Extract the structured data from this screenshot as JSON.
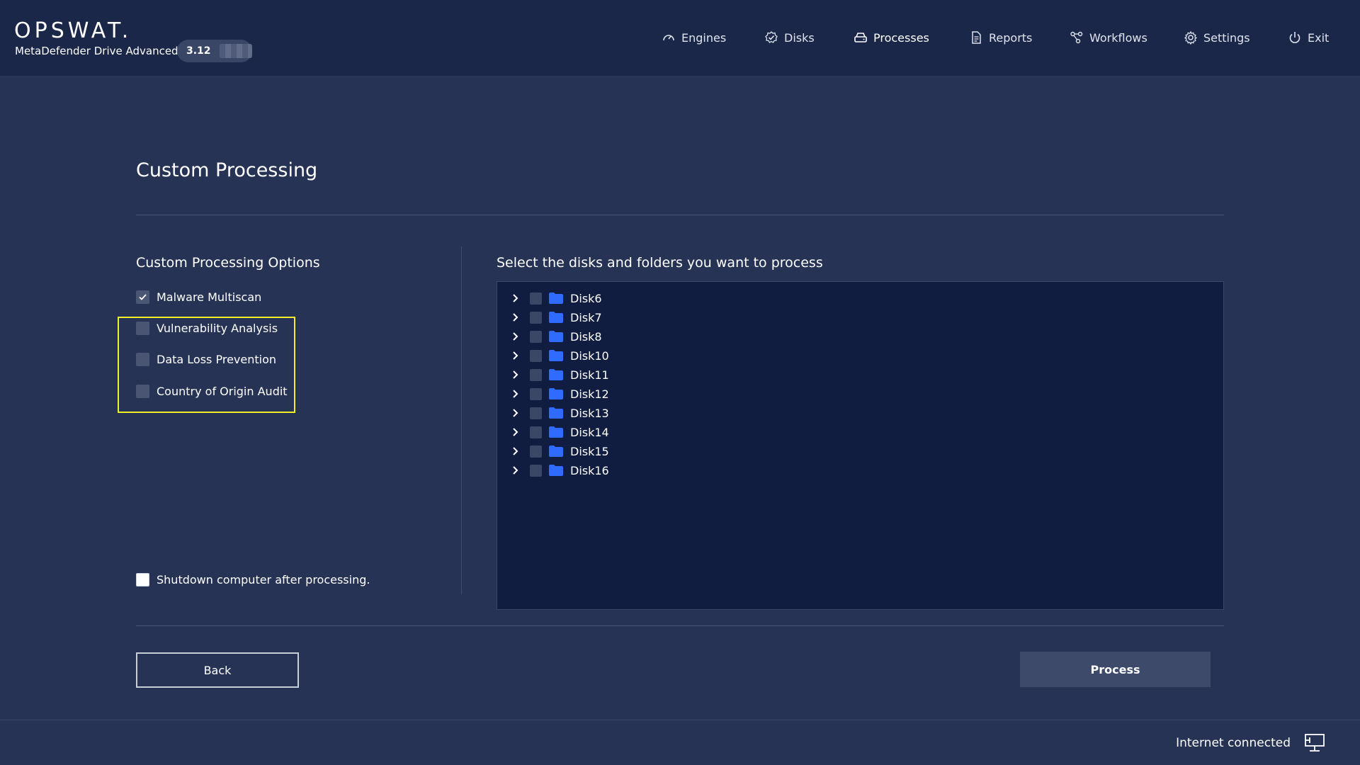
{
  "header": {
    "logo": "OPSWAT.",
    "product": "MetaDefender Drive Advanced",
    "version": "3.12",
    "nav": [
      {
        "label": "Engines",
        "icon": "gauge-icon"
      },
      {
        "label": "Disks",
        "icon": "check-badge-icon"
      },
      {
        "label": "Processes",
        "icon": "drive-icon",
        "active": true
      },
      {
        "label": "Reports",
        "icon": "document-icon"
      },
      {
        "label": "Workflows",
        "icon": "workflow-icon"
      },
      {
        "label": "Settings",
        "icon": "gear-icon"
      },
      {
        "label": "Exit",
        "icon": "power-icon"
      }
    ]
  },
  "page": {
    "title": "Custom Processing"
  },
  "options": {
    "title": "Custom Processing Options",
    "items": [
      {
        "label": "Malware Multiscan",
        "checked": true
      },
      {
        "label": "Vulnerability Analysis",
        "checked": false
      },
      {
        "label": "Data Loss Prevention",
        "checked": false
      },
      {
        "label": "Country of Origin Audit",
        "checked": false
      }
    ],
    "shutdown_label": "Shutdown computer after processing.",
    "shutdown_checked": false
  },
  "tree": {
    "title": "Select the disks and folders you want to process",
    "items": [
      "Disk6",
      "Disk7",
      "Disk8",
      "Disk10",
      "Disk11",
      "Disk12",
      "Disk13",
      "Disk14",
      "Disk15",
      "Disk16"
    ]
  },
  "actions": {
    "back_label": "Back",
    "process_label": "Process"
  },
  "footer": {
    "status": "Internet connected",
    "status_icon": "monitor-network-icon"
  },
  "colors": {
    "background": "#263354",
    "header": "#1b2748",
    "tree_panel": "#111d40",
    "folder": "#2f6bff",
    "highlight": "#f2ee2a"
  }
}
